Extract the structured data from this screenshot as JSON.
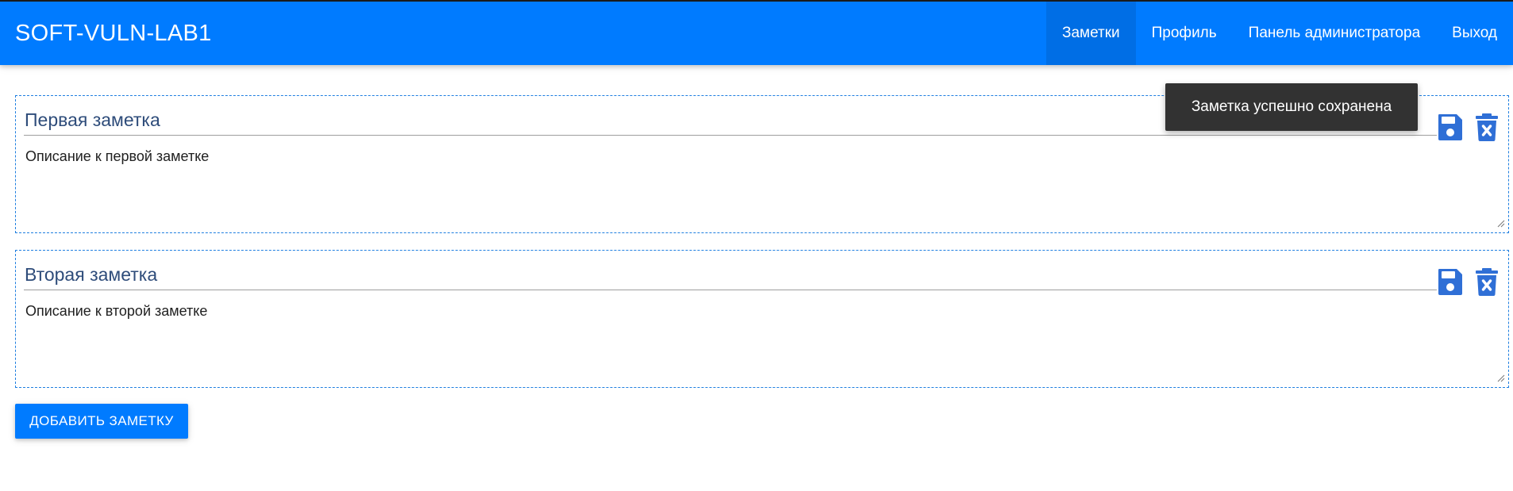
{
  "app": {
    "brand": "SOFT-VULN-LAB1"
  },
  "nav": {
    "items": [
      {
        "label": "Заметки",
        "active": true
      },
      {
        "label": "Профиль",
        "active": false
      },
      {
        "label": "Панель администратора",
        "active": false
      },
      {
        "label": "Выход",
        "active": false
      }
    ]
  },
  "notes": [
    {
      "title": "Первая заметка",
      "description": "Описание к первой заметке"
    },
    {
      "title": "Вторая заметка",
      "description": "Описание к второй заметке"
    }
  ],
  "actions": {
    "add_note_label": "ДОБАВИТЬ ЗАМЕТКУ"
  },
  "toast": {
    "message": "Заметка успешно сохранена"
  },
  "colors": {
    "primary": "#007bff",
    "icon": "#2f6fd6",
    "toast_bg": "#323232"
  },
  "icons": {
    "save": "floppy-disk-icon",
    "delete": "trash-times-icon"
  }
}
